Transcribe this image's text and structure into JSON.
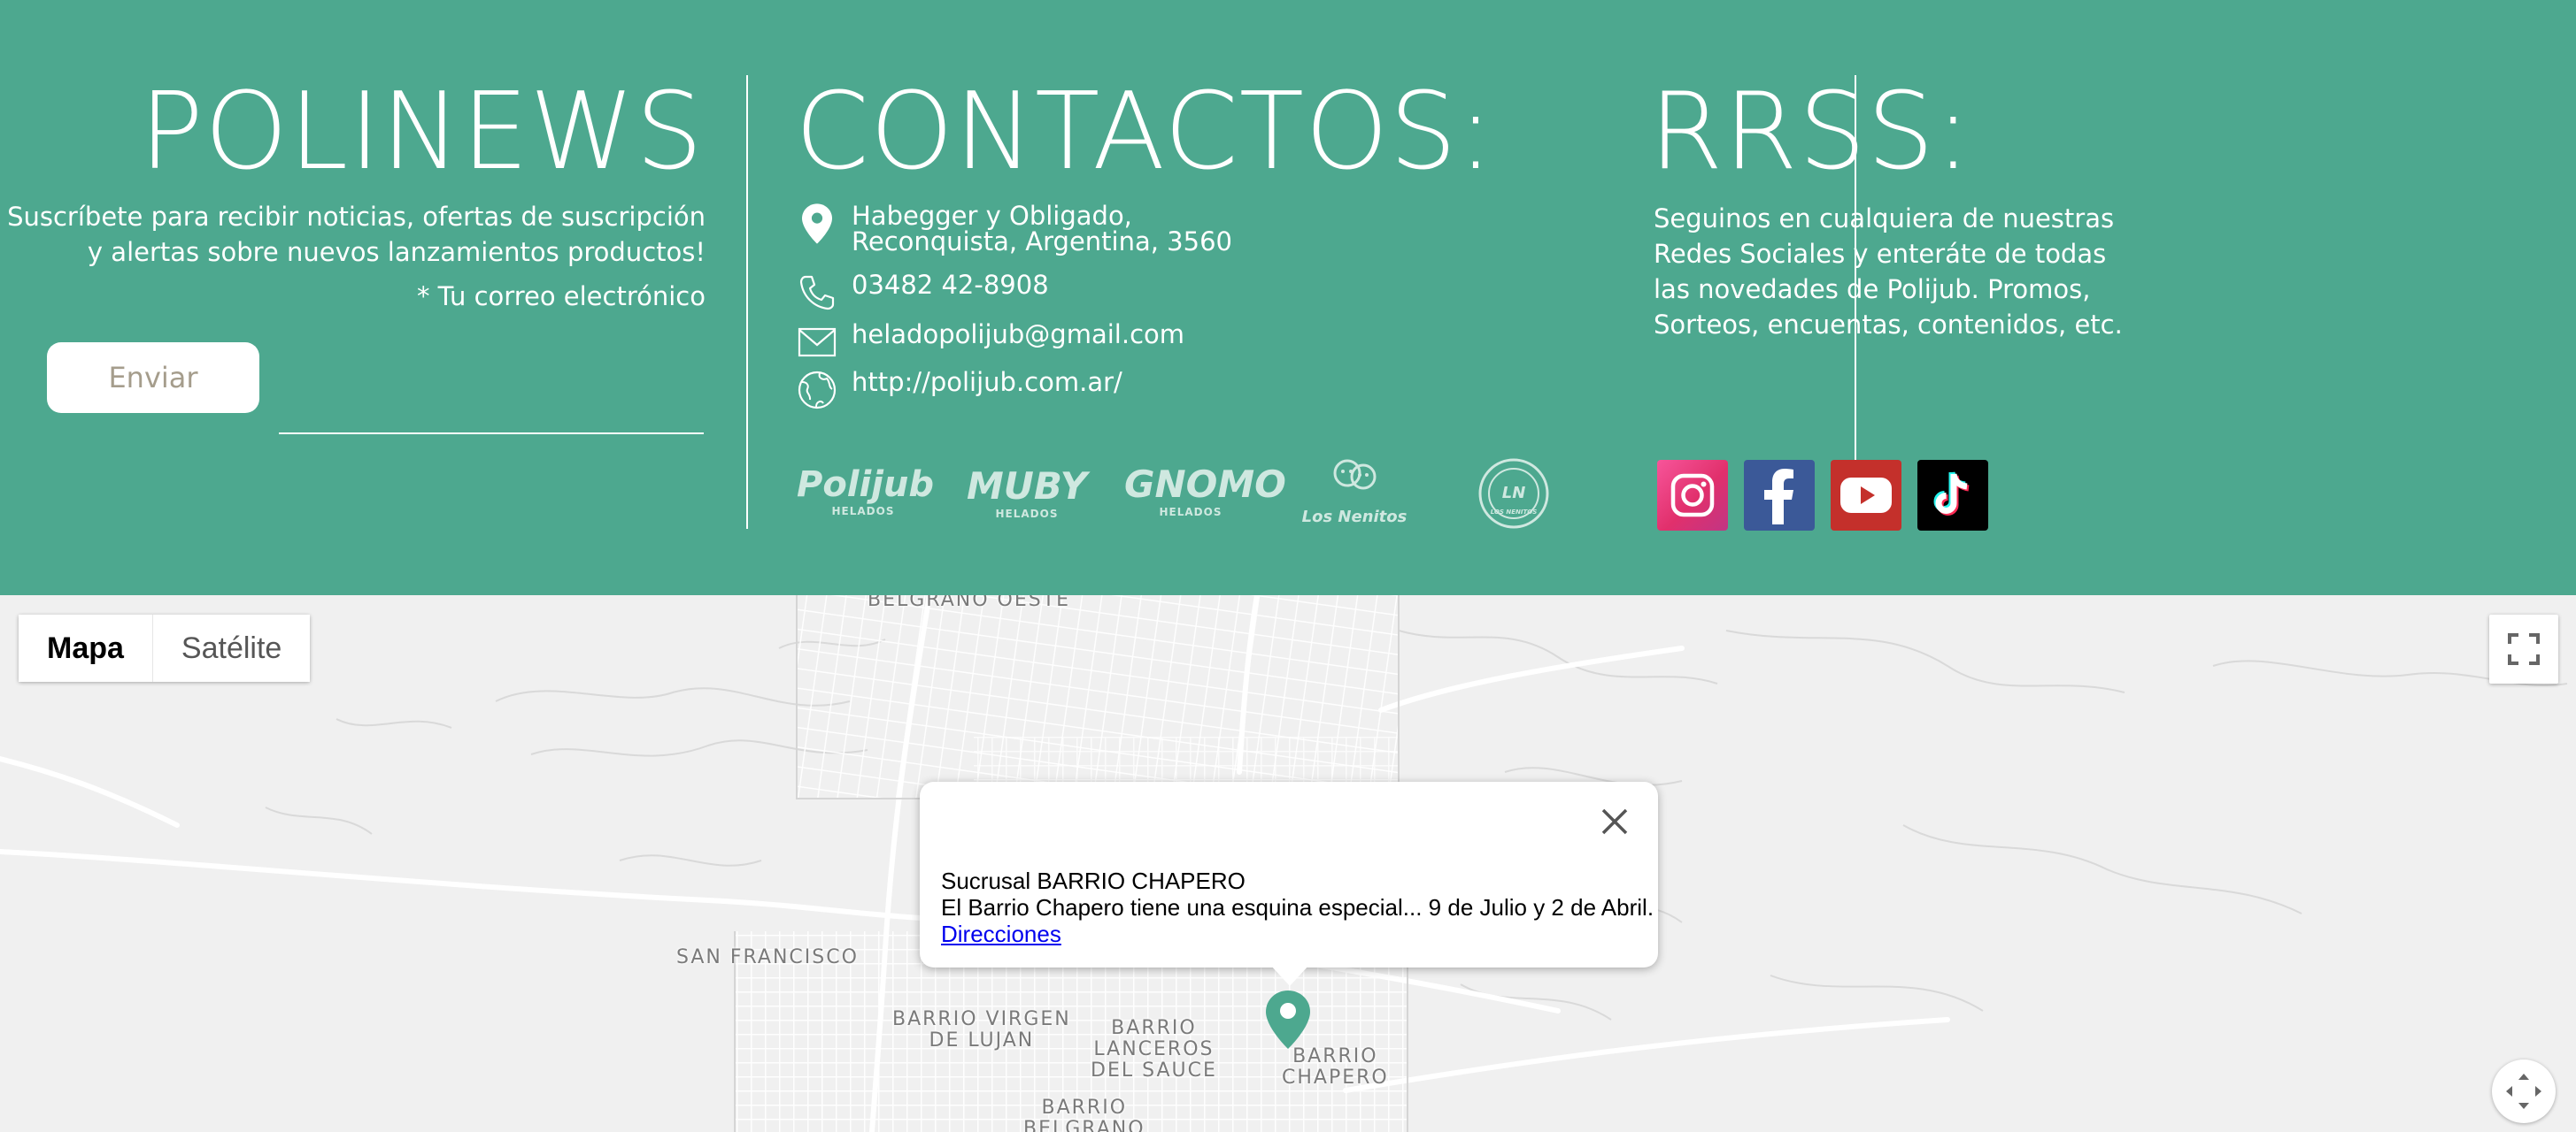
{
  "colors": {
    "footer_bg": "#4da88f",
    "accent": "#4da88f"
  },
  "newsletter": {
    "title": "POLINEWS",
    "description": "Suscríbete para recibir noticias, ofertas de suscripción y alertas sobre nuevos lanzamientos productos!",
    "email_hint": "* Tu correo electrónico",
    "send_label": "Enviar",
    "email_value": ""
  },
  "contacts": {
    "title": "CONTACTOS:",
    "address_line1": "Habegger y Obligado,",
    "address_line2": "Reconquista, Argentina, 3560",
    "phone": "03482 42-8908",
    "email": "heladopolijub@gmail.com",
    "website": "http://polijub.com.ar/",
    "icons": [
      "location-pin-icon",
      "phone-icon",
      "mail-icon",
      "globe-icon"
    ]
  },
  "brands": [
    {
      "name": "Polijub",
      "sub": "HELADOS"
    },
    {
      "name": "MUBY",
      "sub": "HELADOS"
    },
    {
      "name": "GNOMO",
      "sub": "HELADOS"
    },
    {
      "name": "Los Nenitos",
      "sub": ""
    },
    {
      "name": "LOS NENITOS",
      "sub": ""
    }
  ],
  "rrss": {
    "title": "RRSS:",
    "description": "Seguinos en cualquiera de nuestras Redes Sociales y enteráte de todas las novedades de Polijub. Promos, Sorteos, encuentas, contenidos, etc.",
    "networks": [
      "instagram-icon",
      "facebook-icon",
      "youtube-icon",
      "tiktok-icon"
    ]
  },
  "map": {
    "type_options": [
      "Mapa",
      "Satélite"
    ],
    "selected_type": "Mapa",
    "labels": {
      "belgrano_oeste": "BELGRANO OESTE",
      "san_francisco": "SAN FRANCISCO",
      "virgen_1": "BARRIO VIRGEN",
      "virgen_2": "DE LUJAN",
      "lanceros_1": "BARRIO",
      "lanceros_2": "LANCEROS",
      "lanceros_3": "DEL SAUCE",
      "chapero_1": "BARRIO",
      "chapero_2": "CHAPERO",
      "belgrano_1": "BARRIO",
      "belgrano_2": "BELGRANO"
    },
    "info_window": {
      "title": "Sucrusal BARRIO CHAPERO",
      "description": "El Barrio Chapero tiene una esquina especial... 9 de Julio y 2 de Abril.",
      "link": "Direcciones"
    }
  }
}
